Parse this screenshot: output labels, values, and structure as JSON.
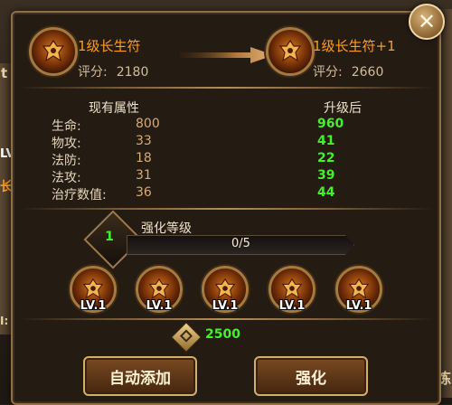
{
  "background": {
    "left_fragment_1": "t",
    "left_fragment_2": "LV",
    "left_fragment_3": "长",
    "right_fragment": "炼",
    "left_fragment_4": "I:"
  },
  "close_label": "✕",
  "current_item": {
    "name": "1级长生符",
    "score_label": "评分:",
    "score_value": "2180"
  },
  "upgraded_item": {
    "name": "1级长生符+1",
    "score_label": "评分:",
    "score_value": "2660"
  },
  "stats": {
    "current_header": "现有属性",
    "upgraded_header": "升级后",
    "rows": [
      {
        "name": "生命:",
        "current": "800",
        "upgraded": "960"
      },
      {
        "name": "物攻:",
        "current": "33",
        "upgraded": "41"
      },
      {
        "name": "法防:",
        "current": "18",
        "upgraded": "22"
      },
      {
        "name": "法攻:",
        "current": "31",
        "upgraded": "39"
      },
      {
        "name": "治疗数值:",
        "current": "36",
        "upgraded": "44"
      }
    ]
  },
  "enhance": {
    "level": "1",
    "title": "强化等级",
    "progress_text": "0/5",
    "progress_fraction": 0
  },
  "slots": [
    {
      "label": "LV.1"
    },
    {
      "label": "LV.1"
    },
    {
      "label": "LV.1"
    },
    {
      "label": "LV.1"
    },
    {
      "label": "LV.1"
    }
  ],
  "cost": {
    "icon": "gold-coin-icon",
    "value": "2500"
  },
  "buttons": {
    "auto_add": "自动添加",
    "enhance": "强化"
  },
  "colors": {
    "green_value": "#45f02d",
    "orange_name": "#ff9d1c",
    "frame_gold": "#8f6f45"
  }
}
